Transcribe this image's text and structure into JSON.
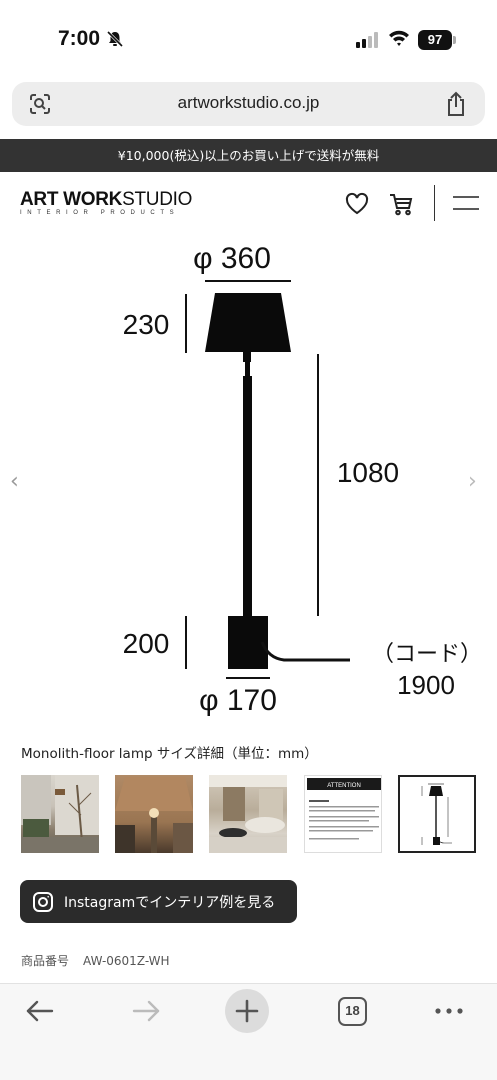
{
  "status": {
    "time": "7:00",
    "battery": "97"
  },
  "browser": {
    "url": "artworkstudio.co.jp",
    "tab_count": "18"
  },
  "banner": {
    "text": "¥10,000(税込)以上のお買い上げで送料が無料"
  },
  "header": {
    "logo_bold": "ART WORK",
    "logo_light": "STUDIO",
    "logo_sub": "INTERIOR PRODUCTS",
    "icons": [
      "heart-icon",
      "cart-icon",
      "menu-icon"
    ]
  },
  "diagram": {
    "shade_diameter": "φ 360",
    "shade_height": "230",
    "pole_height": "1080",
    "base_height": "200",
    "base_diameter": "φ 170",
    "cord_label": "（コード）",
    "cord_length": "1900"
  },
  "caption": "Monolith-floor lamp サイズ詳細（単位：mm）",
  "thumbnail_attention_title": "ATTENTION",
  "instagram": {
    "label": "Instagramでインテリア例を見る"
  },
  "sku": {
    "label": "商品番号",
    "value": "AW-0601Z-WH"
  }
}
